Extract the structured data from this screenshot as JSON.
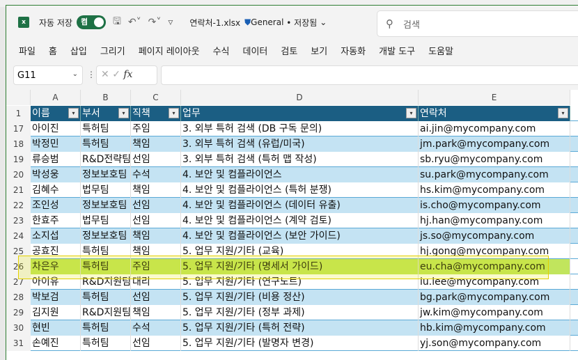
{
  "titlebar": {
    "app_icon": "excel-icon",
    "autosave_label": "자동 저장",
    "toggle_label": "켬",
    "filename": "연락처-1.xlsx",
    "sensitivity": "General",
    "saved_status": "• 저장됨",
    "search_placeholder": "검색"
  },
  "ribbon": [
    "파일",
    "홈",
    "삽입",
    "그리기",
    "페이지 레이아웃",
    "수식",
    "데이터",
    "검토",
    "보기",
    "자동화",
    "개발 도구",
    "도움말"
  ],
  "formula_bar": {
    "name_box": "G11",
    "fx": "fx",
    "value": ""
  },
  "columns": [
    "A",
    "B",
    "C",
    "D",
    "E"
  ],
  "header_row": {
    "num": "1",
    "cells": [
      "이름",
      "부서",
      "직책",
      "업무",
      "연락처"
    ]
  },
  "rows": [
    {
      "num": "17",
      "cells": [
        "아이진",
        "특허팀",
        "주임",
        "3. 외부 특허 검색 (DB 구독 문의)",
        "ai.jin@mycompany.com"
      ]
    },
    {
      "num": "18",
      "cells": [
        "박정민",
        "특허팀",
        "책임",
        "3. 외부 특허 검색 (유럽/미국)",
        "jm.park@mycompany.com"
      ]
    },
    {
      "num": "19",
      "cells": [
        "류승범",
        "R&D전략팀",
        "선임",
        "3. 외부 특허 검색 (특허 맵 작성)",
        "sb.ryu@mycompany.com"
      ]
    },
    {
      "num": "20",
      "cells": [
        "박성웅",
        "정보보호팀",
        "수석",
        "4. 보안 및 컴플라이언스",
        "su.park@mycompany.com"
      ]
    },
    {
      "num": "21",
      "cells": [
        "김혜수",
        "법무팀",
        "책임",
        "4. 보안 및 컴플라이언스 (특허 분쟁)",
        "hs.kim@mycompany.com"
      ]
    },
    {
      "num": "22",
      "cells": [
        "조인성",
        "정보보호팀",
        "선임",
        "4. 보안 및 컴플라이언스 (데이터 유출)",
        "is.cho@mycompany.com"
      ]
    },
    {
      "num": "23",
      "cells": [
        "한효주",
        "법무팀",
        "선임",
        "4. 보안 및 컴플라이언스 (계약 검토)",
        "hj.han@mycompany.com"
      ]
    },
    {
      "num": "24",
      "cells": [
        "소지섭",
        "정보보호팀",
        "책임",
        "4. 보안 및 컴플라이언스 (보안 가이드)",
        "js.so@mycompany.com"
      ]
    },
    {
      "num": "25",
      "cells": [
        "공효진",
        "특허팀",
        "책임",
        "5. 업무 지원/기타 (교육)",
        "hj.gong@mycompany.com"
      ]
    },
    {
      "num": "26",
      "cells": [
        "차은우",
        "특허팀",
        "주임",
        "5. 업무 지원/기타 (명세서 가이드)",
        "eu.cha@mycompany.com"
      ]
    },
    {
      "num": "27",
      "cells": [
        "아이유",
        "R&D지원팀",
        "대리",
        "5. 업무 지원/기타 (연구노트)",
        "iu.lee@mycompany.com"
      ]
    },
    {
      "num": "28",
      "cells": [
        "박보검",
        "특허팀",
        "선임",
        "5. 업무 지원/기타 (비용 정산)",
        "bg.park@mycompany.com"
      ]
    },
    {
      "num": "29",
      "cells": [
        "김지원",
        "R&D지원팀",
        "책임",
        "5. 업무 지원/기타 (정부 과제)",
        "jw.kim@mycompany.com"
      ]
    },
    {
      "num": "30",
      "cells": [
        "현빈",
        "특허팀",
        "수석",
        "5. 업무 지원/기타 (특허 전략)",
        "hb.kim@mycompany.com"
      ]
    },
    {
      "num": "31",
      "cells": [
        "손예진",
        "특허팀",
        "선임",
        "5. 업무 지원/기타 (발명자 변경)",
        "yj.son@mycompany.com"
      ]
    }
  ],
  "highlighted_row": "26"
}
